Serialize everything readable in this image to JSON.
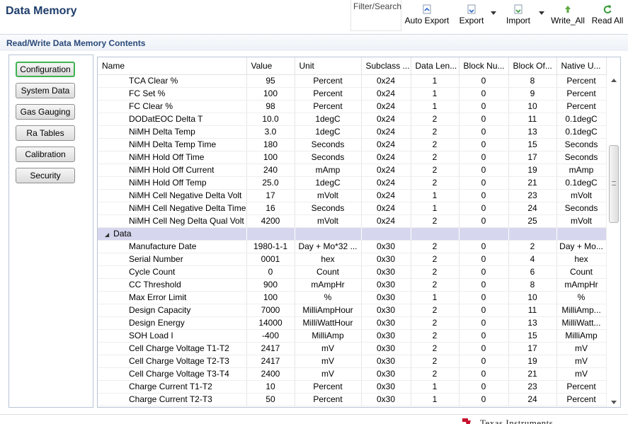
{
  "header": {
    "title": "Data Memory",
    "filter_label": "Filter/Search",
    "toolbar": {
      "auto_export": "Auto Export",
      "export": "Export",
      "import": "Import",
      "write_all": "Write_All",
      "read_all": "Read All"
    }
  },
  "section": {
    "title": "Read/Write Data Memory Contents"
  },
  "categories": [
    "Configuration",
    "System Data",
    "Gas Gauging",
    "Ra Tables",
    "Calibration",
    "Security"
  ],
  "active_category": "Configuration",
  "grid": {
    "columns": [
      "Name",
      "Value",
      "Unit",
      "Subclass ...",
      "Data Len...",
      "Block Nu...",
      "Block Of...",
      "Native U..."
    ],
    "rows_before_group": [
      [
        "TCA Clear %",
        "95",
        "Percent",
        "0x24",
        "1",
        "0",
        "8",
        "Percent"
      ],
      [
        "FC Set %",
        "100",
        "Percent",
        "0x24",
        "1",
        "0",
        "9",
        "Percent"
      ],
      [
        "FC Clear %",
        "98",
        "Percent",
        "0x24",
        "1",
        "0",
        "10",
        "Percent"
      ],
      [
        "DODatEOC Delta T",
        "10.0",
        "1degC",
        "0x24",
        "2",
        "0",
        "11",
        "0.1degC"
      ],
      [
        "NiMH Delta Temp",
        "3.0",
        "1degC",
        "0x24",
        "2",
        "0",
        "13",
        "0.1degC"
      ],
      [
        "NiMH Delta Temp Time",
        "180",
        "Seconds",
        "0x24",
        "2",
        "0",
        "15",
        "Seconds"
      ],
      [
        "NiMH Hold Off  Time",
        "100",
        "Seconds",
        "0x24",
        "2",
        "0",
        "17",
        "Seconds"
      ],
      [
        "NiMH Hold Off Current",
        "240",
        "mAmp",
        "0x24",
        "2",
        "0",
        "19",
        "mAmp"
      ],
      [
        "NiMH Hold Off  Temp",
        "25.0",
        "1degC",
        "0x24",
        "2",
        "0",
        "21",
        "0.1degC"
      ],
      [
        "NiMH Cell Negative Delta Volt",
        "17",
        "mVolt",
        "0x24",
        "1",
        "0",
        "23",
        "mVolt"
      ],
      [
        "NiMH Cell Negative Delta Time",
        "16",
        "Seconds",
        "0x24",
        "1",
        "0",
        "24",
        "Seconds"
      ],
      [
        "NiMH Cell Neg Delta Qual Volt",
        "4200",
        "mVolt",
        "0x24",
        "2",
        "0",
        "25",
        "mVolt"
      ]
    ],
    "group_label": "Data",
    "rows_after_group": [
      [
        "Manufacture Date",
        "1980-1-1",
        "Day + Mo*32 ...",
        "0x30",
        "2",
        "0",
        "2",
        "Day + Mo..."
      ],
      [
        "Serial Number",
        "0001",
        "hex",
        "0x30",
        "2",
        "0",
        "4",
        "hex"
      ],
      [
        "Cycle Count",
        "0",
        "Count",
        "0x30",
        "2",
        "0",
        "6",
        "Count"
      ],
      [
        "CC Threshold",
        "900",
        "mAmpHr",
        "0x30",
        "2",
        "0",
        "8",
        "mAmpHr"
      ],
      [
        "Max Error Limit",
        "100",
        "%",
        "0x30",
        "1",
        "0",
        "10",
        "%"
      ],
      [
        "Design Capacity",
        "7000",
        "MilliAmpHour",
        "0x30",
        "2",
        "0",
        "11",
        "MilliAmp..."
      ],
      [
        "Design Energy",
        "14000",
        "MilliWattHour",
        "0x30",
        "2",
        "0",
        "13",
        "MilliWatt..."
      ],
      [
        "SOH Load I",
        "-400",
        "MilliAmp",
        "0x30",
        "2",
        "0",
        "15",
        "MilliAmp"
      ],
      [
        "Cell Charge Voltage T1-T2",
        "2417",
        "mV",
        "0x30",
        "2",
        "0",
        "17",
        "mV"
      ],
      [
        "Cell Charge Voltage T2-T3",
        "2417",
        "mV",
        "0x30",
        "2",
        "0",
        "19",
        "mV"
      ],
      [
        "Cell Charge Voltage T3-T4",
        "2400",
        "mV",
        "0x30",
        "2",
        "0",
        "21",
        "mV"
      ],
      [
        "Charge Current T1-T2",
        "10",
        "Percent",
        "0x30",
        "1",
        "0",
        "23",
        "Percent"
      ],
      [
        "Charge Current  T2-T3",
        "50",
        "Percent",
        "0x30",
        "1",
        "0",
        "24",
        "Percent"
      ]
    ]
  },
  "footer": {
    "logo_text": "Texas Instruments"
  },
  "colors": {
    "accent": "#1f3e6b",
    "group_row": "#d6d6ee",
    "active_border": "#3fb34f"
  }
}
